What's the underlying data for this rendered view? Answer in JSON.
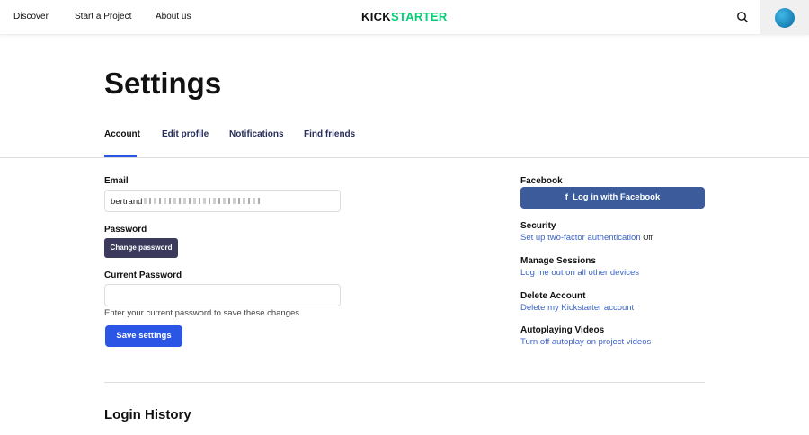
{
  "nav": {
    "discover": "Discover",
    "start": "Start a Project",
    "about": "About us"
  },
  "logo": {
    "part1": "KICK",
    "part2": "STARTER"
  },
  "page_title": "Settings",
  "tabs": [
    "Account",
    "Edit profile",
    "Notifications",
    "Find friends"
  ],
  "form": {
    "email_label": "Email",
    "email_value": "bertrand",
    "password_label": "Password",
    "change_password": "Change password",
    "current_password_label": "Current Password",
    "current_password_value": "",
    "hint": "Enter your current password to save these changes.",
    "save": "Save settings"
  },
  "side": {
    "facebook_label": "Facebook",
    "facebook_button": "Log in with Facebook",
    "security_label": "Security",
    "security_link": "Set up two-factor authentication",
    "security_status": "Off",
    "sessions_label": "Manage Sessions",
    "sessions_link": "Log me out on all other devices",
    "delete_label": "Delete Account",
    "delete_link": "Delete my Kickstarter account",
    "autoplay_label": "Autoplaying Videos",
    "autoplay_link": "Turn off autoplay on project videos"
  },
  "login_history": "Login History",
  "colors": {
    "accent": "#2a55e5",
    "brand": "#05ce78",
    "facebook": "#3b5b9b",
    "dark_button": "#3b3a5c"
  }
}
